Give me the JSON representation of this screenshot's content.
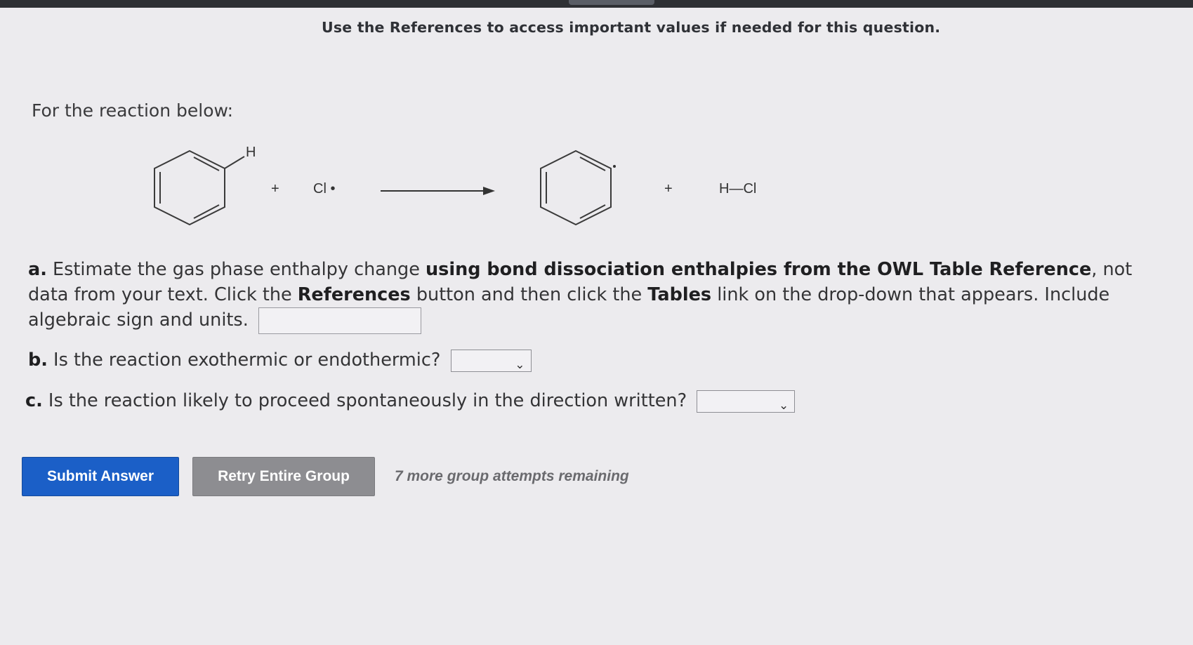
{
  "header": {
    "instruction": "Use the References to access important values if needed for this question."
  },
  "question": {
    "intro": "For the reaction below:",
    "reaction": {
      "reactant1_h_label": "H",
      "plus1": "+",
      "reactant2": "Cl •",
      "plus2": "+",
      "product2": "H—Cl"
    },
    "part_a": {
      "letter": "a.",
      "text1": " Estimate the gas phase enthalpy change ",
      "bold1": "using bond dissociation enthalpies from the OWL Table Reference",
      "text2": ", not data from your text. Click the ",
      "bold2": "References",
      "text3": " button and then click the ",
      "bold3": "Tables",
      "text4": " link on the drop-down that appears. Include algebraic sign and units.",
      "input_value": ""
    },
    "part_b": {
      "letter": "b.",
      "text": " Is the reaction exothermic or endothermic?",
      "selected": ""
    },
    "part_c": {
      "letter": "c.",
      "text": " Is the reaction likely to proceed spontaneously in the direction written?",
      "selected": ""
    }
  },
  "actions": {
    "submit_label": "Submit Answer",
    "retry_label": "Retry Entire Group",
    "attempts_text": "7 more group attempts remaining"
  },
  "colors": {
    "submit": "#1b5fc7",
    "retry": "#8d8d91",
    "background": "#ecebee"
  }
}
